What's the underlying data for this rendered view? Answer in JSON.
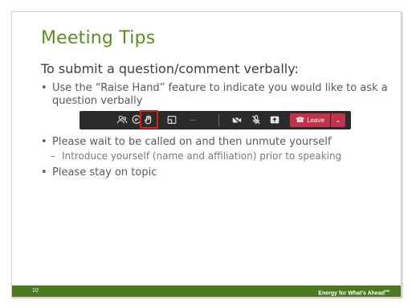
{
  "slide": {
    "title": "Meeting Tips",
    "subtitle": "To submit a question/comment verbally:",
    "bullets": [
      "Use the “Raise Hand” feature to indicate you would like to ask a question verbally",
      "Please wait to be called on and then unmute yourself",
      "Please stay on topic"
    ],
    "sub_bullets": [
      "Introduce yourself (name and affiliation) prior to speaking"
    ],
    "bullet_char": "•",
    "dash_char": "–"
  },
  "toolbar": {
    "icons": [
      "participants-icon",
      "chat-icon",
      "raise-hand-icon",
      "rooms-icon",
      "more-icon",
      "camera-off-icon",
      "mic-off-icon",
      "share-icon"
    ],
    "more_label": "···",
    "leave_label": "Leave",
    "leave_caret": "⌄",
    "highlight_color": "#e01d1d",
    "leave_color": "#c4314b"
  },
  "footer": {
    "page_number": "10",
    "tagline": "Energy for What’s Ahead",
    "tagline_mark": "SM",
    "color": "#4b7a1e"
  },
  "colors": {
    "title": "#5b8f22",
    "toolbar_bg": "#2b2b2b"
  }
}
